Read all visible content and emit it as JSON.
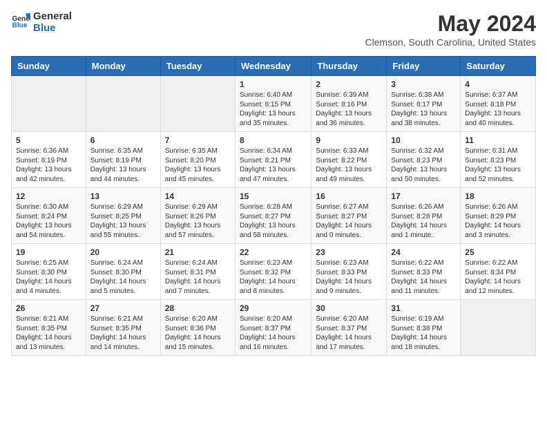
{
  "header": {
    "logo_general": "General",
    "logo_blue": "Blue",
    "month_title": "May 2024",
    "location": "Clemson, South Carolina, United States"
  },
  "weekdays": [
    "Sunday",
    "Monday",
    "Tuesday",
    "Wednesday",
    "Thursday",
    "Friday",
    "Saturday"
  ],
  "weeks": [
    [
      {
        "day": "",
        "info": ""
      },
      {
        "day": "",
        "info": ""
      },
      {
        "day": "",
        "info": ""
      },
      {
        "day": "1",
        "info": "Sunrise: 6:40 AM\nSunset: 8:15 PM\nDaylight: 13 hours and 35 minutes."
      },
      {
        "day": "2",
        "info": "Sunrise: 6:39 AM\nSunset: 8:16 PM\nDaylight: 13 hours and 36 minutes."
      },
      {
        "day": "3",
        "info": "Sunrise: 6:38 AM\nSunset: 8:17 PM\nDaylight: 13 hours and 38 minutes."
      },
      {
        "day": "4",
        "info": "Sunrise: 6:37 AM\nSunset: 8:18 PM\nDaylight: 13 hours and 40 minutes."
      }
    ],
    [
      {
        "day": "5",
        "info": "Sunrise: 6:36 AM\nSunset: 8:19 PM\nDaylight: 13 hours and 42 minutes."
      },
      {
        "day": "6",
        "info": "Sunrise: 6:35 AM\nSunset: 8:19 PM\nDaylight: 13 hours and 44 minutes."
      },
      {
        "day": "7",
        "info": "Sunrise: 6:35 AM\nSunset: 8:20 PM\nDaylight: 13 hours and 45 minutes."
      },
      {
        "day": "8",
        "info": "Sunrise: 6:34 AM\nSunset: 8:21 PM\nDaylight: 13 hours and 47 minutes."
      },
      {
        "day": "9",
        "info": "Sunrise: 6:33 AM\nSunset: 8:22 PM\nDaylight: 13 hours and 49 minutes."
      },
      {
        "day": "10",
        "info": "Sunrise: 6:32 AM\nSunset: 8:23 PM\nDaylight: 13 hours and 50 minutes."
      },
      {
        "day": "11",
        "info": "Sunrise: 6:31 AM\nSunset: 8:23 PM\nDaylight: 13 hours and 52 minutes."
      }
    ],
    [
      {
        "day": "12",
        "info": "Sunrise: 6:30 AM\nSunset: 8:24 PM\nDaylight: 13 hours and 54 minutes."
      },
      {
        "day": "13",
        "info": "Sunrise: 6:29 AM\nSunset: 8:25 PM\nDaylight: 13 hours and 55 minutes."
      },
      {
        "day": "14",
        "info": "Sunrise: 6:29 AM\nSunset: 8:26 PM\nDaylight: 13 hours and 57 minutes."
      },
      {
        "day": "15",
        "info": "Sunrise: 6:28 AM\nSunset: 8:27 PM\nDaylight: 13 hours and 58 minutes."
      },
      {
        "day": "16",
        "info": "Sunrise: 6:27 AM\nSunset: 8:27 PM\nDaylight: 14 hours and 0 minutes."
      },
      {
        "day": "17",
        "info": "Sunrise: 6:26 AM\nSunset: 8:28 PM\nDaylight: 14 hours and 1 minute."
      },
      {
        "day": "18",
        "info": "Sunrise: 6:26 AM\nSunset: 8:29 PM\nDaylight: 14 hours and 3 minutes."
      }
    ],
    [
      {
        "day": "19",
        "info": "Sunrise: 6:25 AM\nSunset: 8:30 PM\nDaylight: 14 hours and 4 minutes."
      },
      {
        "day": "20",
        "info": "Sunrise: 6:24 AM\nSunset: 8:30 PM\nDaylight: 14 hours and 5 minutes."
      },
      {
        "day": "21",
        "info": "Sunrise: 6:24 AM\nSunset: 8:31 PM\nDaylight: 14 hours and 7 minutes."
      },
      {
        "day": "22",
        "info": "Sunrise: 6:23 AM\nSunset: 8:32 PM\nDaylight: 14 hours and 8 minutes."
      },
      {
        "day": "23",
        "info": "Sunrise: 6:23 AM\nSunset: 8:33 PM\nDaylight: 14 hours and 9 minutes."
      },
      {
        "day": "24",
        "info": "Sunrise: 6:22 AM\nSunset: 8:33 PM\nDaylight: 14 hours and 11 minutes."
      },
      {
        "day": "25",
        "info": "Sunrise: 6:22 AM\nSunset: 8:34 PM\nDaylight: 14 hours and 12 minutes."
      }
    ],
    [
      {
        "day": "26",
        "info": "Sunrise: 6:21 AM\nSunset: 8:35 PM\nDaylight: 14 hours and 13 minutes."
      },
      {
        "day": "27",
        "info": "Sunrise: 6:21 AM\nSunset: 8:35 PM\nDaylight: 14 hours and 14 minutes."
      },
      {
        "day": "28",
        "info": "Sunrise: 6:20 AM\nSunset: 8:36 PM\nDaylight: 14 hours and 15 minutes."
      },
      {
        "day": "29",
        "info": "Sunrise: 6:20 AM\nSunset: 8:37 PM\nDaylight: 14 hours and 16 minutes."
      },
      {
        "day": "30",
        "info": "Sunrise: 6:20 AM\nSunset: 8:37 PM\nDaylight: 14 hours and 17 minutes."
      },
      {
        "day": "31",
        "info": "Sunrise: 6:19 AM\nSunset: 8:38 PM\nDaylight: 14 hours and 18 minutes."
      },
      {
        "day": "",
        "info": ""
      }
    ]
  ]
}
